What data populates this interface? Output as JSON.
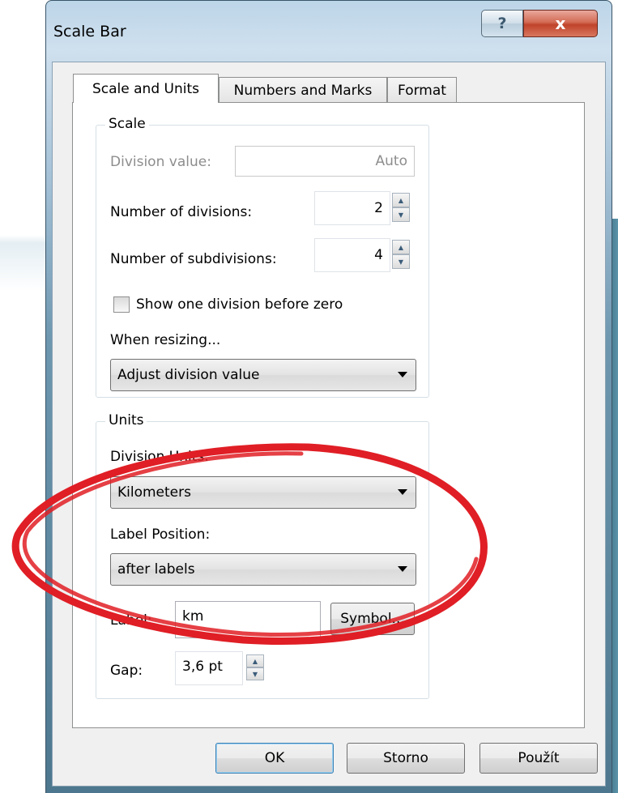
{
  "window": {
    "title": "Scale Bar",
    "help_glyph": "?",
    "close_glyph": "x"
  },
  "tabs": [
    {
      "label": "Scale and Units",
      "active": true
    },
    {
      "label": "Numbers and Marks",
      "active": false
    },
    {
      "label": "Format",
      "active": false
    }
  ],
  "scale_group": {
    "title": "Scale",
    "division_value_label": "Division value:",
    "division_value": "Auto",
    "num_divisions_label": "Number of divisions:",
    "num_divisions": "2",
    "num_subdivisions_label": "Number of subdivisions:",
    "num_subdivisions": "4",
    "show_before_zero_label": "Show one division before zero",
    "show_before_zero_checked": false,
    "when_resizing_label": "When resizing...",
    "when_resizing_value": "Adjust division value"
  },
  "units_group": {
    "title": "Units",
    "division_units_label": "Division Units:",
    "division_units_value": "Kilometers",
    "label_position_label": "Label Position:",
    "label_position_value": "after labels",
    "label_label": "Label:",
    "label_value": "km",
    "symbol_button": "Symbol...",
    "gap_label": "Gap:",
    "gap_value": "3,6 pt"
  },
  "footer": {
    "ok": "OK",
    "cancel": "Storno",
    "apply": "Použít"
  },
  "colors": {
    "annotation_ellipse": "#e01e25"
  },
  "icons": {
    "spin_up": "▲",
    "spin_down": "▼"
  }
}
